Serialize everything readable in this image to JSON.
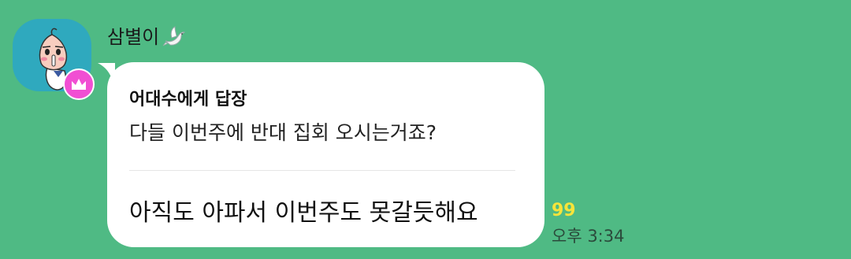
{
  "chat": {
    "sender_name": "삼별이",
    "sender_emoji_icon": "dove-icon",
    "avatar_icon": "peach-character-avatar",
    "badge_icon": "crown-icon",
    "reply": {
      "to_label": "어대수에게 답장",
      "quoted_text": "다들 이번주에 반대 집회 오시는거죠?"
    },
    "message_text": "아직도 아파서 이번주도 못갈듯해요",
    "unread_count": "99",
    "timestamp": "오후 3:34"
  },
  "colors": {
    "background": "#4FBA84",
    "bubble": "#FFFFFF",
    "avatar_bg": "#2FA9BE",
    "badge": "#F14FD3",
    "unread": "#F7E43A"
  }
}
